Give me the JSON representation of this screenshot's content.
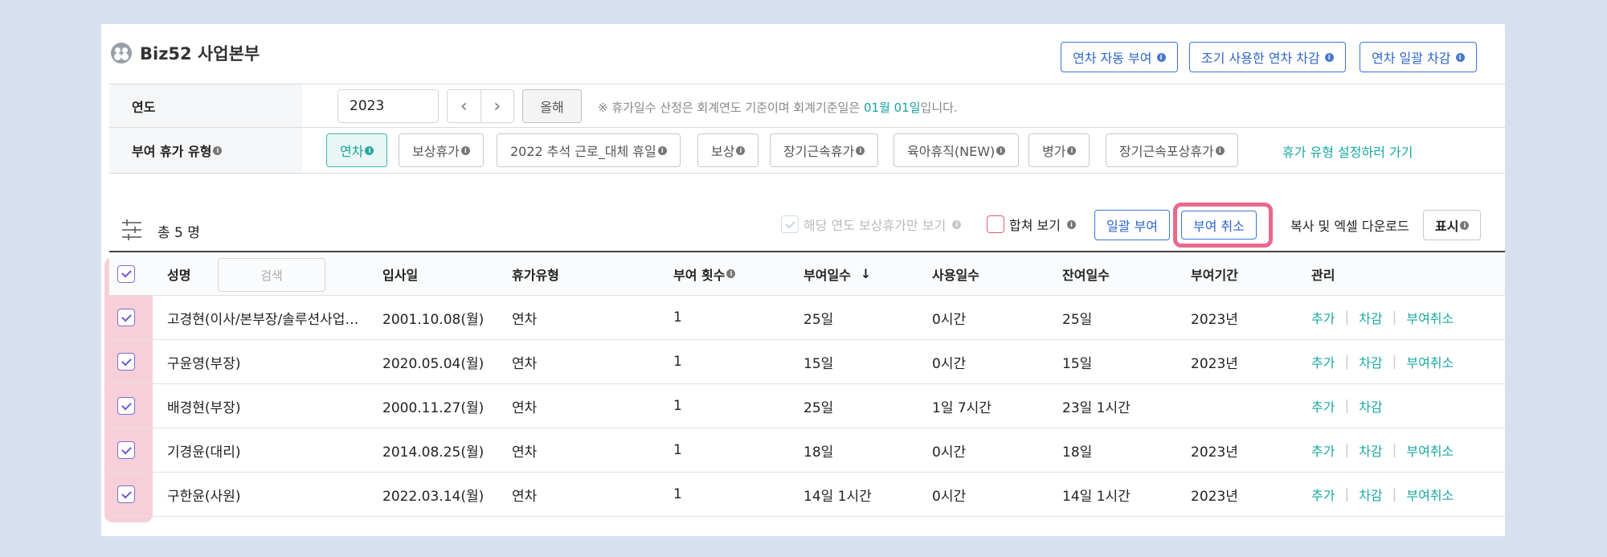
{
  "header": {
    "title": "Biz52 사업본부"
  },
  "top_buttons": [
    "연차 자동 부여",
    "조기 사용한 연차 차감",
    "연차 일괄 차감"
  ],
  "year_filter": {
    "label": "연도",
    "value": "2023",
    "this_year": "올해",
    "note_prefix": "※ 휴가일수 산정은 회계연도 기준이며 회계기준일은 ",
    "note_date": "01월 01일",
    "note_suffix": "입니다."
  },
  "type_filter": {
    "label": "부여 휴가 유형",
    "types": [
      "연차",
      "보상휴가",
      "2022 추석 근로_대체 휴일",
      "보상",
      "장기근속휴가",
      "육아휴직(NEW)",
      "병가",
      "장기근속포상휴가"
    ],
    "active": "연차",
    "link": "휴가 유형 설정하러 가기"
  },
  "toolbar": {
    "total": "총 5 명",
    "only_comp_label": "해당 연도 보상휴가만 보기",
    "merge_label": "합쳐 보기",
    "bulk_grant": "일괄 부여",
    "cancel_grant": "부여 취소",
    "copy_excel": "복사 및 엑셀 다운로드",
    "display": "표시"
  },
  "table": {
    "headers": {
      "name": "성명",
      "search_placeholder": "검색",
      "join_date": "입사일",
      "leave_type": "휴가유형",
      "grant_count": "부여 횟수",
      "grant_days": "부여일수",
      "sort_arrow": "↓",
      "used_days": "사용일수",
      "remaining_days": "잔여일수",
      "grant_period": "부여기간",
      "manage": "관리"
    },
    "rows": [
      {
        "name": "고경현(이사/본부장/솔루션사업…",
        "join_date": "2001.10.08(월)",
        "leave_type": "연차",
        "grant_count": "1",
        "grant_days": "25일",
        "used_days": "0시간",
        "remaining_days": "25일",
        "grant_period": "2023년",
        "actions": [
          "추가",
          "차감",
          "부여취소"
        ]
      },
      {
        "name": "구윤영(부장)",
        "join_date": "2020.05.04(월)",
        "leave_type": "연차",
        "grant_count": "1",
        "grant_days": "15일",
        "used_days": "0시간",
        "remaining_days": "15일",
        "grant_period": "2023년",
        "actions": [
          "추가",
          "차감",
          "부여취소"
        ]
      },
      {
        "name": "배경현(부장)",
        "join_date": "2000.11.27(월)",
        "leave_type": "연차",
        "grant_count": "1",
        "grant_days": "25일",
        "used_days": "1일 7시간",
        "remaining_days": "23일 1시간",
        "grant_period": "",
        "actions": [
          "추가",
          "차감"
        ]
      },
      {
        "name": "기경윤(대리)",
        "join_date": "2014.08.25(월)",
        "leave_type": "연차",
        "grant_count": "1",
        "grant_days": "18일",
        "used_days": "0시간",
        "remaining_days": "18일",
        "grant_period": "2023년",
        "actions": [
          "추가",
          "차감",
          "부여취소"
        ]
      },
      {
        "name": "구한윤(사원)",
        "join_date": "2022.03.14(월)",
        "leave_type": "연차",
        "grant_count": "1",
        "grant_days": "14일 1시간",
        "used_days": "0시간",
        "remaining_days": "14일 1시간",
        "grant_period": "2023년",
        "actions": [
          "추가",
          "차감",
          "부여취소"
        ]
      }
    ]
  },
  "colors": {
    "accent_blue": "#3b74d9",
    "teal": "#1aa8a2",
    "highlight_pink": "#e96a8c",
    "check_purple": "#6a5dd0"
  }
}
